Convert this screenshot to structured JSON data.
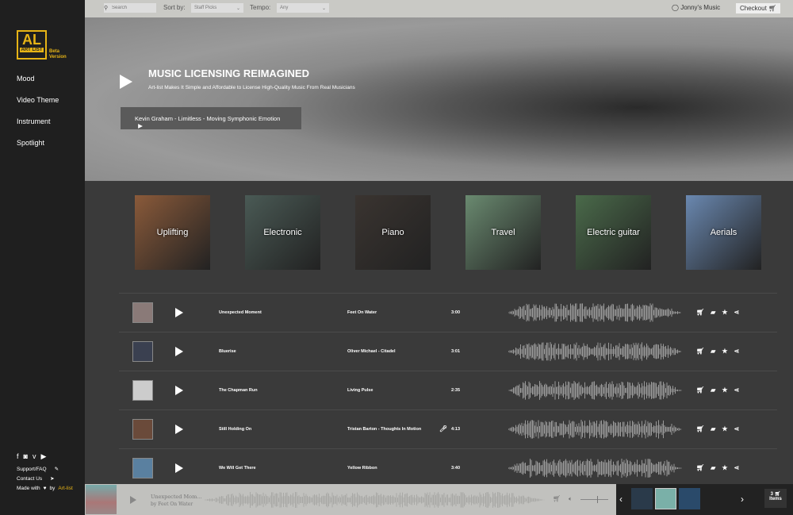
{
  "sidebar": {
    "logo_text": "AL",
    "logo_sub": "ART LIST",
    "beta": "Beta",
    "version": "Version",
    "nav": [
      "Mood",
      "Video Theme",
      "Instrument",
      "Spotlight"
    ],
    "support": "Support/FAQ",
    "contact": "Contact Us",
    "made_with": "Made with",
    "by": "by",
    "brand": "Art-list"
  },
  "topbar": {
    "search_placeholder": "Search",
    "sort_label": "Sort by:",
    "sort_value": "Staff Picks",
    "tempo_label": "Tempo:",
    "tempo_value": "Any",
    "user": "Jonny's Music",
    "checkout": "Checkout"
  },
  "hero": {
    "title": "MUSIC LICENSING REIMAGINED",
    "subtitle": "Art-list Makes It Simple and Affordable to License High-Quality Music From Real Musicians",
    "featured": "Kevin Graham - Limitless - Moving Symphonic Emotion"
  },
  "categories": [
    {
      "label": "Uplifting",
      "color": "#8a5a3a"
    },
    {
      "label": "Electronic",
      "color": "#4a5a55"
    },
    {
      "label": "Piano",
      "color": "#3a3430"
    },
    {
      "label": "Travel",
      "color": "#6a8a70"
    },
    {
      "label": "Electric guitar",
      "color": "#4a6a4a"
    },
    {
      "label": "Aerials",
      "color": "#6a88b0"
    }
  ],
  "tracks": [
    {
      "title": "Unexpected Moment",
      "artist": "Feet On Water",
      "duration": "3:00",
      "vocal": false,
      "thumb": "#8a7a78"
    },
    {
      "title": "Bluerise",
      "artist": "Oliver Michael - Citadel",
      "duration": "3:01",
      "vocal": false,
      "thumb": "#3a4050"
    },
    {
      "title": "The Chapman Run",
      "artist": "Living Pulse",
      "duration": "2:35",
      "vocal": false,
      "thumb": "#ccc"
    },
    {
      "title": "Still Holding On",
      "artist": "Tristan Barton - Thoughts In Motion",
      "duration": "4:13",
      "vocal": true,
      "thumb": "#6a4a3a"
    },
    {
      "title": "We Will Get There",
      "artist": "Yellow Ribbon",
      "duration": "3:40",
      "vocal": false,
      "thumb": "#5a80a0"
    }
  ],
  "player": {
    "title": "Unexpected Mom...",
    "by": "by Feet On Water",
    "volume": 0.6,
    "progress": 0.0
  },
  "cart": {
    "count": "3",
    "label": "Items"
  }
}
